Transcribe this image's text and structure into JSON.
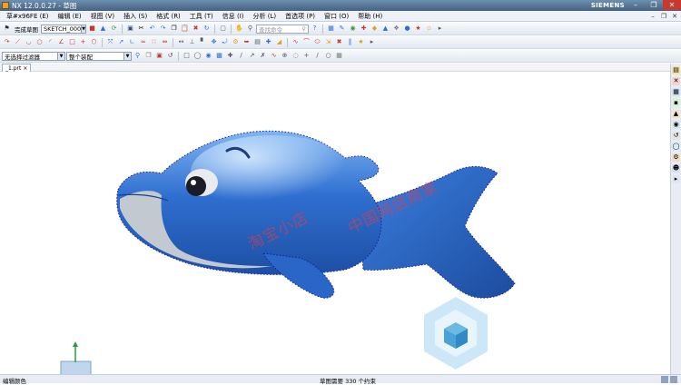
{
  "window": {
    "title": "NX 12.0.0.27 - 草图",
    "brand": "SIEMENS"
  },
  "menu": [
    {
      "label": "草#x96FE (E)"
    },
    {
      "label": "编辑 (E)"
    },
    {
      "label": "视图 (V)"
    },
    {
      "label": "插入 (S)"
    },
    {
      "label": "格式 (R)"
    },
    {
      "label": "工具 (T)"
    },
    {
      "label": "信息 (I)"
    },
    {
      "label": "分析 (L)"
    },
    {
      "label": "首选项 (P)"
    },
    {
      "label": "窗口 (O)"
    },
    {
      "label": "帮助 (H)"
    }
  ],
  "toolbar1": {
    "finish_sketch_label": "完成草图",
    "sketch_select": "SKETCH_000",
    "search_placeholder": "查找命令"
  },
  "toolbar3": {
    "filter_select": "无选择过滤器",
    "assembly_select": "整个装配"
  },
  "tab": {
    "label": "_1.prt"
  },
  "watermark": {
    "line1": "淘宝小店",
    "line2": "中国网店商家"
  },
  "status": {
    "left": "编辑颜色",
    "center": "草图需要 330 个约束"
  },
  "colors": {
    "accent": "#3b6fb6",
    "model_blue": "#2f6fd0",
    "curve_points": "#1a1aa8"
  },
  "icons": {
    "window_controls": [
      "minimize-icon",
      "restore-icon",
      "close-icon"
    ],
    "coord_system": "wcs-triad-icon",
    "logo": "cube-hexagon-logo"
  }
}
